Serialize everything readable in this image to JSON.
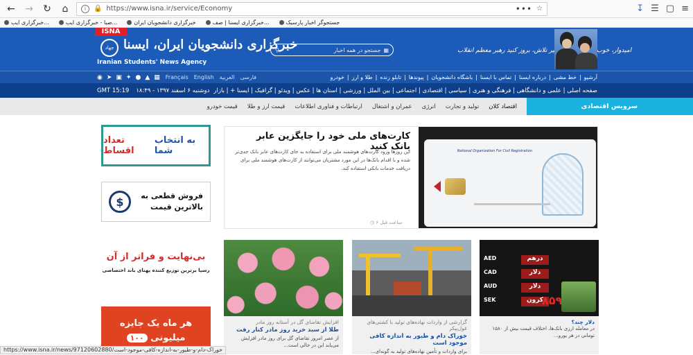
{
  "browser": {
    "url": "https://www.isna.ir/service/Economy",
    "url_extra": "•••",
    "bookmarks": [
      "خبرگزاری ایب...",
      "صبا - خبرگزاری ایب...",
      "خبرگزاری دانشجویان ایران",
      "خبرگزاری ایسنا | صف...",
      "جستجوگر اخبار پارسیک"
    ]
  },
  "header": {
    "isna_tag": "ISNA",
    "logo_text": "جهاد",
    "site_name_fa": "خبرگزاری دانشجویان ایران، ایسنا",
    "site_name_en": "Iranian Students' News Agency",
    "search_placeholder": "جستجو در همه اخبار",
    "slogan": "امیدوار، خوب، مینوند امید، تغییر تلاش، بروز کنید   رهبر معظم انقلاب"
  },
  "sub_nav": {
    "social_icons": [
      "rss-icon",
      "telegram-icon",
      "instagram-icon",
      "twitter-icon",
      "apple-icon",
      "android-icon",
      "windows-icon"
    ],
    "languages": [
      "Français",
      "English",
      "العربية",
      "فارسی"
    ],
    "links": [
      "آرشیو",
      "خط مشی",
      "درباره ایسنا",
      "تماس با ایسنا",
      "باشگاه دانشجویان",
      "پیوندها",
      "تابلو زنده",
      "طلا و ارز",
      "خودرو"
    ]
  },
  "main_nav": {
    "time": "GMT 15:19",
    "date": "دوشنبه ۶ اسفند ۱۳۹۷ - ۱۸:۴۹",
    "categories": "صفحه اصلی | علمی و دانشگاهی | فرهنگی و هنری | سیاسی | اقتصادی | اجتماعی | بین الملل | ورزشی | استان ها | عکس | ویدئو | گرافیک | ایسنا + | بازار"
  },
  "service_nav": {
    "title": "سرویس اقتصادی",
    "items": [
      "اقتصاد کلان",
      "تولید و تجارت",
      "انرژی",
      "عمران و اشتغال",
      "ارتباطات و فناوری اطلاعات",
      "قیمت ارز و طلا",
      "قیمت خودرو"
    ]
  },
  "ads": {
    "ad1_red": "تعداد اقساط",
    "ad1_blue": "به انتخاب شما",
    "ad2_line1": "فروش قطعی به",
    "ad2_line2": "بالاترین قیمت",
    "ad2_icon": "$",
    "ad3_line1": "بی‌نهایت و فراتر از آن",
    "ad3_line2": "رسپا برترین توزیع کننده پهنای باند اختصاصی",
    "ad4_line1": "هر ماه یک جایزه",
    "ad4_pill": "۱۰۰",
    "ad4_line2": "میلیونی"
  },
  "featured": {
    "title": "کارت‌های ملی خود را جایگزین عابر بانک کنید",
    "desc": "این روزها ورود کارت‌های هوشمند ملی برای استفاده به جای کارت‌های عابر بانک جدی‌تر شده و با اقدام بانک‌ها در این مورد مشتریان می‌توانند از کارت‌های هوشمند ملی برای دریافت خدمات بانکی استفاده کند.",
    "time": "۶ ساعت قبل",
    "card_title": "National Organization For Civil Registration"
  },
  "cards": [
    {
      "kicker": "افزایش تقاضای گل در آستانه روز مادر",
      "title": "طلا از سبد خرید روز مادر کنار رفت",
      "lead": "از عصر امروز تقاضای گل برای روز مادر افزایش می‌یابد این در حالی است..."
    },
    {
      "kicker": "گزارشی از واردات نهاده‌های تولید با کشتی‌های غول‌پیکر",
      "title": "خوراک دام و طیور به اندازه کافی موجود است",
      "lead": "برای واردات و تأمین نهاده‌های تولید به گونه‌ای..."
    },
    {
      "kicker": "دلار چند؟",
      "title": "",
      "lead": "در معامله ارزی بانک‌ها، اختلاف قیمت بیش از ۱۵۸۰ تومانی در هر یورو..."
    }
  ],
  "exchange_board": {
    "rows": [
      {
        "code": "AED",
        "label": "درهم"
      },
      {
        "code": "CAD",
        "label": "دلار"
      },
      {
        "code": "AUD",
        "label": "دلار"
      },
      {
        "code": "SEK",
        "label": "کرون"
      }
    ],
    "big": "۸۵۹"
  },
  "status_bar": "https://www.isna.ir/news/97120602880/خوراک-دام-و-طیور-به-اندازه-کافی-موجود-است"
}
